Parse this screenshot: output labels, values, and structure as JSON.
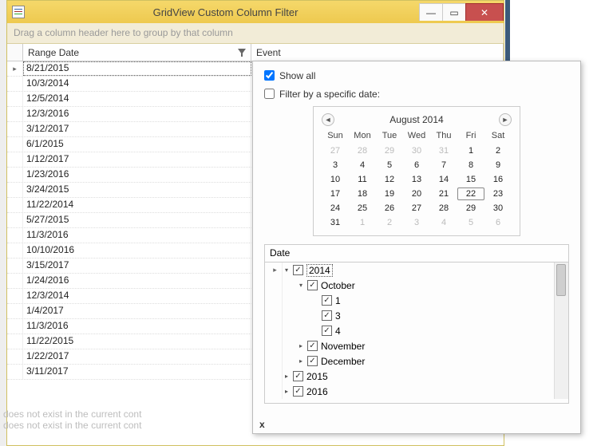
{
  "window": {
    "title": "GridView Custom Column Filter",
    "minimize": "—",
    "maximize": "▭",
    "close": "✕"
  },
  "group_panel_text": "Drag a column header here to group by that column",
  "columns": {
    "range": "Range Date",
    "event": "Event"
  },
  "focused_indicator": "▸",
  "rows": [
    "8/21/2015",
    "10/3/2014",
    "12/5/2014",
    "12/3/2016",
    "3/12/2017",
    "6/1/2015",
    "1/12/2017",
    "1/23/2016",
    "3/24/2015",
    "11/22/2014",
    "5/27/2015",
    "11/3/2016",
    "10/10/2016",
    "3/15/2017",
    "1/24/2016",
    "12/3/2014",
    "1/4/2017",
    "11/3/2016",
    "11/22/2015",
    "1/22/2017",
    "3/11/2017"
  ],
  "popup": {
    "show_all": {
      "label": "Show all",
      "checked": true
    },
    "filter_specific": {
      "label": "Filter by a specific date:",
      "checked": false
    },
    "footer_close": "x"
  },
  "calendar": {
    "month_label": "August 2014",
    "dows": [
      "Sun",
      "Mon",
      "Tue",
      "Wed",
      "Thu",
      "Fri",
      "Sat"
    ],
    "weeks": [
      [
        {
          "d": "27",
          "o": true
        },
        {
          "d": "28",
          "o": true
        },
        {
          "d": "29",
          "o": true
        },
        {
          "d": "30",
          "o": true
        },
        {
          "d": "31",
          "o": true
        },
        {
          "d": "1"
        },
        {
          "d": "2"
        }
      ],
      [
        {
          "d": "3"
        },
        {
          "d": "4"
        },
        {
          "d": "5"
        },
        {
          "d": "6"
        },
        {
          "d": "7"
        },
        {
          "d": "8"
        },
        {
          "d": "9"
        }
      ],
      [
        {
          "d": "10"
        },
        {
          "d": "11"
        },
        {
          "d": "12"
        },
        {
          "d": "13"
        },
        {
          "d": "14"
        },
        {
          "d": "15"
        },
        {
          "d": "16"
        }
      ],
      [
        {
          "d": "17"
        },
        {
          "d": "18"
        },
        {
          "d": "19"
        },
        {
          "d": "20"
        },
        {
          "d": "21"
        },
        {
          "d": "22",
          "t": true
        },
        {
          "d": "23"
        }
      ],
      [
        {
          "d": "24"
        },
        {
          "d": "25"
        },
        {
          "d": "26"
        },
        {
          "d": "27"
        },
        {
          "d": "28"
        },
        {
          "d": "29"
        },
        {
          "d": "30"
        }
      ],
      [
        {
          "d": "31"
        },
        {
          "d": "1",
          "o": true
        },
        {
          "d": "2",
          "o": true
        },
        {
          "d": "3",
          "o": true
        },
        {
          "d": "4",
          "o": true
        },
        {
          "d": "5",
          "o": true
        },
        {
          "d": "6",
          "o": true
        }
      ]
    ],
    "prev": "◄",
    "next": "►"
  },
  "filter_grid": {
    "header": "Date",
    "tree": [
      {
        "indent": 0,
        "exp": "▾",
        "chk": true,
        "label": "2014",
        "focused": true,
        "ind": "▸"
      },
      {
        "indent": 1,
        "exp": "▾",
        "chk": true,
        "label": "October"
      },
      {
        "indent": 2,
        "exp": "",
        "chk": true,
        "label": "1"
      },
      {
        "indent": 2,
        "exp": "",
        "chk": true,
        "label": "3"
      },
      {
        "indent": 2,
        "exp": "",
        "chk": true,
        "label": "4"
      },
      {
        "indent": 1,
        "exp": "▸",
        "chk": true,
        "label": "November"
      },
      {
        "indent": 1,
        "exp": "▸",
        "chk": true,
        "label": "December"
      },
      {
        "indent": 0,
        "exp": "▸",
        "chk": true,
        "label": "2015"
      },
      {
        "indent": 0,
        "exp": "▸",
        "chk": true,
        "label": "2016"
      }
    ]
  },
  "behind_text": {
    "l1": "does not exist in the current cont",
    "l2": "does not exist in the current cont"
  }
}
